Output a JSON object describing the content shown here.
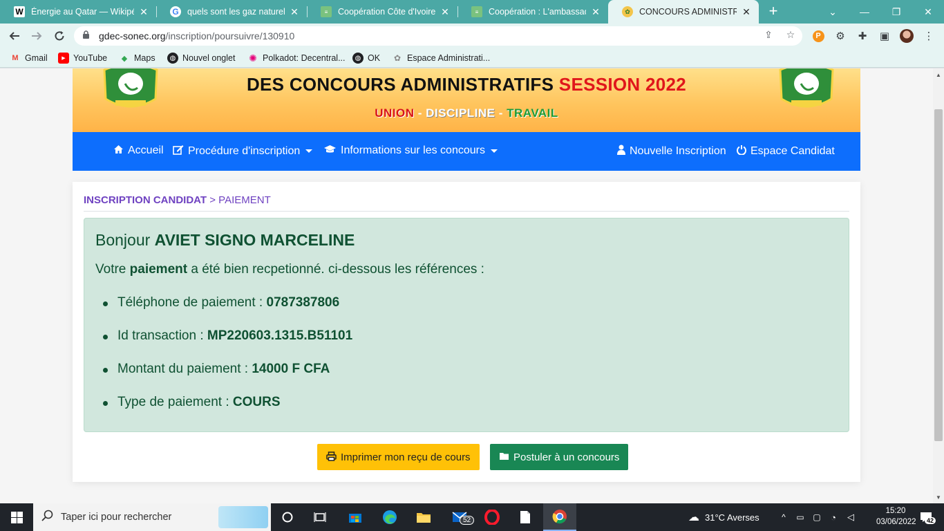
{
  "browser": {
    "tabs": [
      {
        "title": "Énergie au Qatar — Wikipédi",
        "icon": "wikipedia-icon"
      },
      {
        "title": "quels sont les gaz naturels - R",
        "icon": "google-icon"
      },
      {
        "title": "Coopération Côte d'Ivoire-Qa",
        "icon": "site-icon"
      },
      {
        "title": "Coopération : L'ambassadeur",
        "icon": "site-icon"
      },
      {
        "title": "CONCOURS ADMINISTRATIF",
        "icon": "emblem-icon"
      }
    ],
    "url_host": "gdec-sonec.org",
    "url_path": "/inscription/poursuivre/130910",
    "bookmarks": [
      {
        "label": "Gmail",
        "icon": "gmail-icon"
      },
      {
        "label": "YouTube",
        "icon": "youtube-icon"
      },
      {
        "label": "Maps",
        "icon": "maps-icon"
      },
      {
        "label": "Nouvel onglet",
        "icon": "globe-icon"
      },
      {
        "label": "Polkadot: Decentral...",
        "icon": "polkadot-icon"
      },
      {
        "label": "OK",
        "icon": "globe-icon"
      },
      {
        "label": "Espace Administrati...",
        "icon": "emblem-icon"
      }
    ]
  },
  "banner": {
    "title_main": "DES CONCOURS ADMINISTRATIFS",
    "title_session": "SESSION 2022",
    "motto_union": "UNION",
    "motto_sep": "-",
    "motto_discipline": "DISCIPLINE",
    "motto_travail": "TRAVAIL",
    "colors": {
      "union": "#d8141a",
      "discipline": "#ffffff",
      "travail": "#1e9b38",
      "session": "#e0161b"
    }
  },
  "nav": {
    "home": "Accueil",
    "procedure": "Procédure d'inscription",
    "informations": "Informations sur les concours",
    "new_registration": "Nouvelle Inscription",
    "candidate_space": "Espace Candidat",
    "accent": "#0d6efd"
  },
  "breadcrumb": {
    "section": "INSCRIPTION CANDIDAT",
    "separator": ">",
    "current": "PAIEMENT"
  },
  "receipt": {
    "greeting": "Bonjour",
    "name": "AVIET SIGNO MARCELINE",
    "message_prefix": "Votre",
    "message_bold": "paiement",
    "message_suffix": "a été bien recpetionné. ci-dessous les références :",
    "items": [
      {
        "label": "Téléphone de paiement :",
        "value": "0787387806"
      },
      {
        "label": "Id transaction :",
        "value": "MP220603.1315.B51101"
      },
      {
        "label": "Montant du paiement :",
        "value": "14000 F CFA"
      },
      {
        "label": "Type de paiement :",
        "value": "COURS"
      }
    ]
  },
  "actions": {
    "print": "Imprimer mon reçu de cours",
    "apply": "Postuler à un concours"
  },
  "taskbar": {
    "search_placeholder": "Taper ici pour rechercher",
    "mail_badge": "52",
    "weather": "31°C  Averses",
    "time": "15:20",
    "date": "03/06/2022",
    "notifications": "42"
  }
}
